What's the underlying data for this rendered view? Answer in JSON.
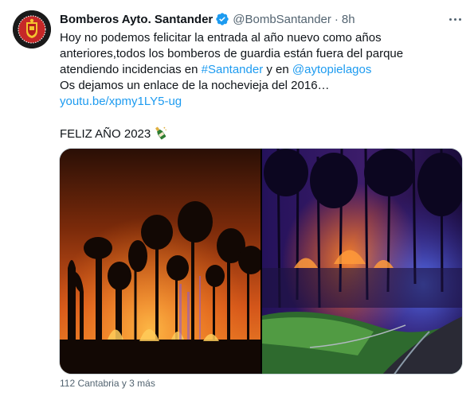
{
  "tweet": {
    "author_name": "Bomberos Ayto. Santander",
    "handle": "@BombSantander",
    "separator": "·",
    "time": "8h",
    "lines": [
      "Hoy no podemos felicitar la entrada al año nuevo como años",
      "anteriores,todos los bomberos de guardia están fuera del parque"
    ],
    "line3_text": "atendiendo incidencias en ",
    "hashtag": "#Santander",
    "line3_mid": " y en ",
    "mention": "@aytopielagos",
    "line4": "Os dejamos un enlace de la nochevieja del 2016…",
    "link": "youtu.be/xpmy1LY5-ug",
    "greeting": "FELIZ AÑO 2023",
    "tagged": "112 Cantabria y 3 más"
  },
  "icons": {
    "avatar": "fire-department-crest-icon",
    "verified": "verified-badge-icon",
    "more": "more-options-icon",
    "emoji": "champagne-bottle-emoji"
  },
  "colors": {
    "link": "#1d9bf0",
    "secondary_text": "#536471",
    "verified": "#1d9bf0"
  },
  "media": {
    "photos": [
      "forest-fire-night-photo",
      "forest-fire-blue-lights-photo"
    ]
  }
}
